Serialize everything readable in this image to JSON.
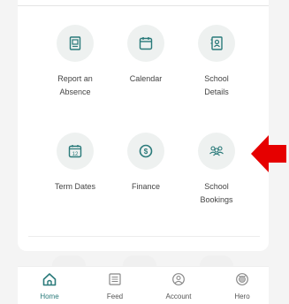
{
  "tiles": [
    {
      "label": "Report an\nAbsence",
      "icon": "absence-icon"
    },
    {
      "label": "Calendar",
      "icon": "calendar-icon"
    },
    {
      "label": "School\nDetails",
      "icon": "school-details-icon"
    },
    {
      "label": "Term Dates",
      "icon": "term-dates-icon"
    },
    {
      "label": "Finance",
      "icon": "finance-icon"
    },
    {
      "label": "School\nBookings",
      "icon": "bookings-icon"
    }
  ],
  "term_dates_day": "12",
  "finance_symbol": "$",
  "nav": [
    {
      "label": "Home",
      "icon": "home-icon",
      "active": true
    },
    {
      "label": "Feed",
      "icon": "feed-icon"
    },
    {
      "label": "Account",
      "icon": "account-icon"
    },
    {
      "label": "Hero",
      "icon": "hero-icon"
    }
  ],
  "colors": {
    "accent": "#2a7a7a",
    "arrow": "#e60000"
  }
}
